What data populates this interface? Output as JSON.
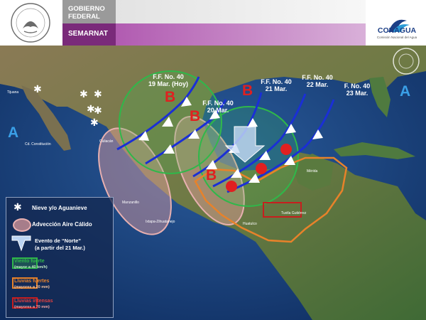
{
  "header": {
    "gobierno_line1": "GOBIERNO",
    "gobierno_line2": "FEDERAL",
    "semarnat": "SEMARNAT",
    "conagua": "CONAGUA",
    "conagua_sub": "Comisión Nacional del Agua"
  },
  "pressure": {
    "high": "A",
    "low": "B"
  },
  "fronts": [
    {
      "label_line1": "F.F. No. 40",
      "label_line2": "19 Mar. (Hoy)"
    },
    {
      "label_line1": "F.F. No. 40",
      "label_line2": "20 Mar."
    },
    {
      "label_line1": "F.F. No. 40",
      "label_line2": "21 Mar."
    },
    {
      "label_line1": "F.F. No. 40",
      "label_line2": "22 Mar."
    },
    {
      "label_line1": "F. No. 40",
      "label_line2": "23 Mar."
    }
  ],
  "legend": {
    "snow": "Nieve y/o Aguanieve",
    "warm_air": "Advección Aire Cálido",
    "norte_line1": "Evento de “Norte”",
    "norte_line2": "(a partir del 21 Mar.)",
    "wind_title": "Viento fuerte",
    "wind_sub": "(mayor a 40 km/h)",
    "rain_title": "Lluvias fuertes",
    "rain_sub": "(mayores a 20 mm)",
    "intense_title": "Lluvias intensas",
    "intense_sub": "(mayores a 70 mm)"
  },
  "map_labels": {
    "culiacan": "Culiacán",
    "tijuana": "Tijuana",
    "cd_constitucion": "Cd. Constitución",
    "merida": "Mérida",
    "huatulco": "Huatulco",
    "tuxtla": "Tuxtla Gutiérrez",
    "manzanillo": "Manzanillo",
    "ixtapa": "Ixtapa-Zihuatanejo"
  },
  "colors": {
    "front": "#1a2fd6",
    "low": "#e02020",
    "wind": "#2fb84a",
    "rain": "#e8822a",
    "intense": "#c81e1e",
    "warm": "#d9a0a0"
  }
}
